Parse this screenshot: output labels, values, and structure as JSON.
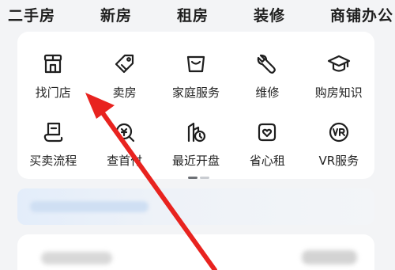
{
  "top_nav": {
    "items": [
      "二手房",
      "新房",
      "租房",
      "装修",
      "商铺办公"
    ]
  },
  "services": {
    "row1": [
      {
        "label": "找门店",
        "icon": "store-icon"
      },
      {
        "label": "卖房",
        "icon": "tag-icon"
      },
      {
        "label": "家庭服务",
        "icon": "basket-icon"
      },
      {
        "label": "维修",
        "icon": "wrench-icon"
      },
      {
        "label": "购房知识",
        "icon": "graduation-cap-icon"
      }
    ],
    "row2": [
      {
        "label": "买卖流程",
        "icon": "document-icon"
      },
      {
        "label": "查首付",
        "icon": "search-money-icon"
      },
      {
        "label": "最近开盘",
        "icon": "building-clock-icon"
      },
      {
        "label": "省心租",
        "icon": "heart-house-icon"
      },
      {
        "label": "VR服务",
        "icon": "vr-icon"
      }
    ]
  },
  "colors": {
    "annotation_arrow": "#e8231f",
    "icon_stroke": "#1e1e1e"
  }
}
